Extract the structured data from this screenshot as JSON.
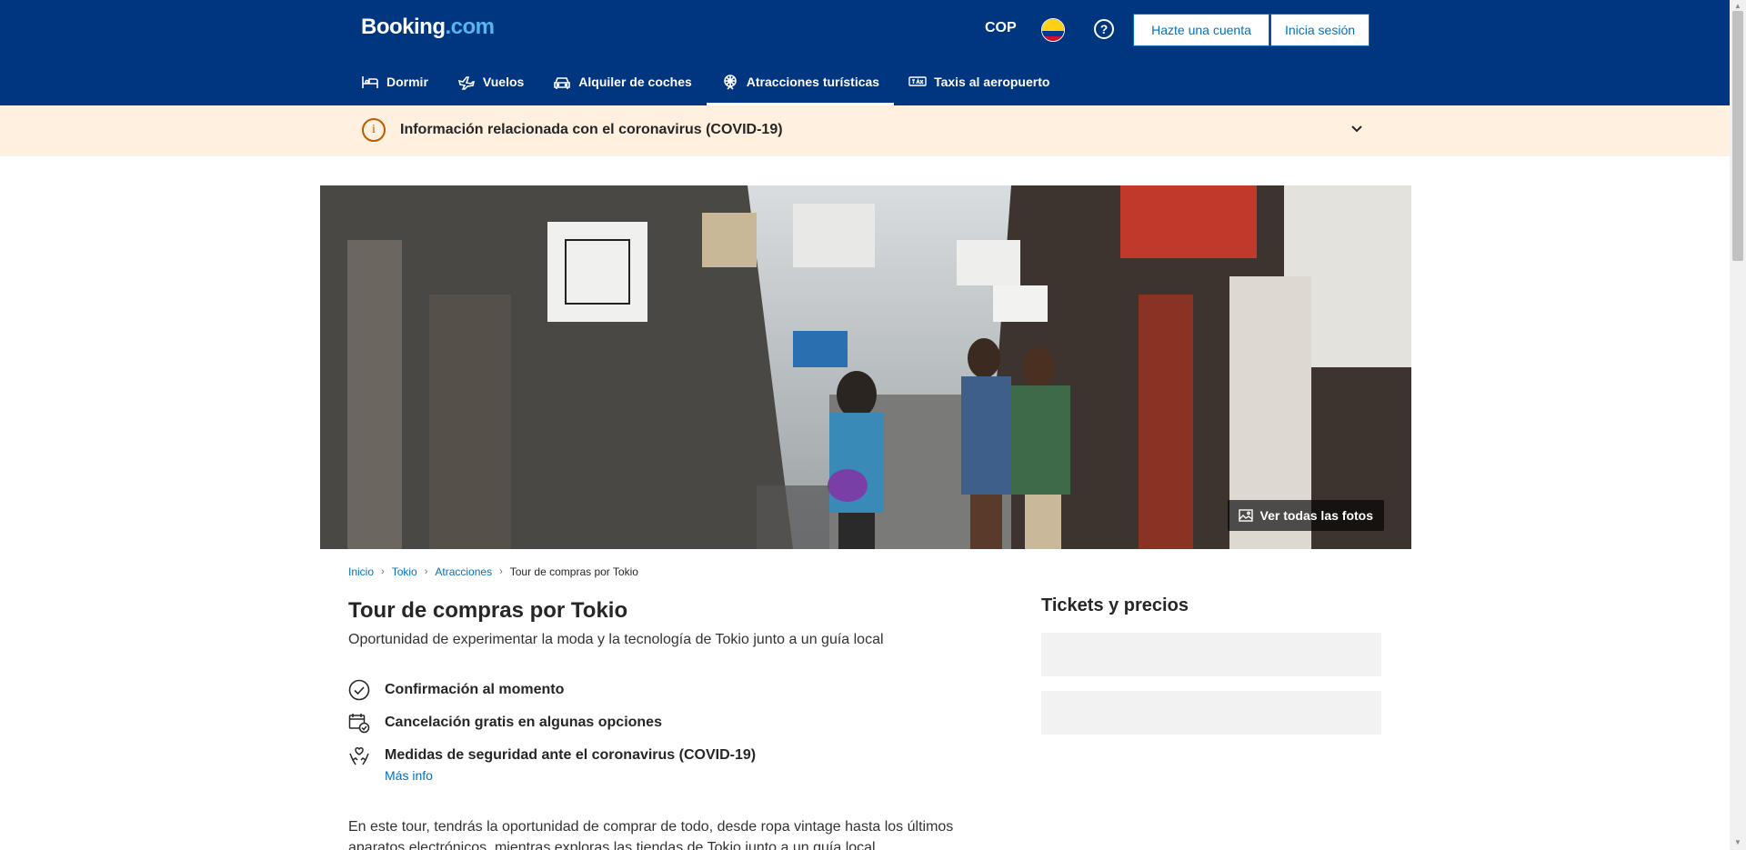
{
  "header": {
    "logo_main": "Booking",
    "logo_suffix": ".com",
    "currency": "COP",
    "help_symbol": "?",
    "register_label": "Hazte una cuenta",
    "login_label": "Inicia sesión"
  },
  "nav": {
    "items": [
      {
        "label": "Dormir",
        "icon": "bed-icon",
        "active": false
      },
      {
        "label": "Vuelos",
        "icon": "plane-icon",
        "active": false
      },
      {
        "label": "Alquiler de coches",
        "icon": "car-icon",
        "active": false
      },
      {
        "label": "Atracciones turísticas",
        "icon": "attractions-icon",
        "active": true
      },
      {
        "label": "Taxis al aeropuerto",
        "icon": "taxi-icon",
        "active": false
      }
    ]
  },
  "covid_banner": {
    "icon_symbol": "i",
    "text": "Información relacionada con el coronavirus (COVID-19)"
  },
  "hero": {
    "photos_button": "Ver todas las fotos"
  },
  "breadcrumb": {
    "items": [
      "Inicio",
      "Tokio",
      "Atracciones"
    ],
    "current": "Tour de compras por Tokio"
  },
  "main": {
    "title": "Tour de compras por Tokio",
    "subtitle": "Oportunidad de experimentar la moda y la tecnología de Tokio junto a un guía local",
    "features": [
      {
        "text": "Confirmación al momento",
        "icon": "check-circle-icon"
      },
      {
        "text": "Cancelación gratis en algunas opciones",
        "icon": "calendar-check-icon"
      },
      {
        "text": "Medidas de seguridad ante el coronavirus (COVID-19)",
        "icon": "heart-hands-icon",
        "link": "Más info"
      }
    ],
    "description": "En este tour, tendrás la oportunidad de comprar de todo, desde ropa vintage hasta los últimos aparatos electrónicos, mientras exploras las tiendas de Tokio junto a un guía local."
  },
  "sidebar": {
    "title": "Tickets y precios"
  },
  "colors": {
    "brand_blue": "#003580",
    "link_blue": "#0071c2",
    "covid_bg": "#fff0e0",
    "covid_accent": "#bc5b01"
  }
}
